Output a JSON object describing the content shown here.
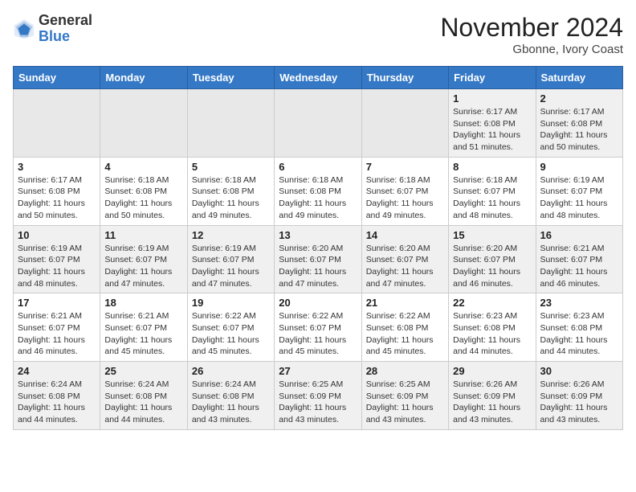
{
  "header": {
    "logo_general": "General",
    "logo_blue": "Blue",
    "month_year": "November 2024",
    "location": "Gbonne, Ivory Coast"
  },
  "weekdays": [
    "Sunday",
    "Monday",
    "Tuesday",
    "Wednesday",
    "Thursday",
    "Friday",
    "Saturday"
  ],
  "weeks": [
    [
      {
        "day": "",
        "info": ""
      },
      {
        "day": "",
        "info": ""
      },
      {
        "day": "",
        "info": ""
      },
      {
        "day": "",
        "info": ""
      },
      {
        "day": "",
        "info": ""
      },
      {
        "day": "1",
        "info": "Sunrise: 6:17 AM\nSunset: 6:08 PM\nDaylight: 11 hours and 51 minutes."
      },
      {
        "day": "2",
        "info": "Sunrise: 6:17 AM\nSunset: 6:08 PM\nDaylight: 11 hours and 50 minutes."
      }
    ],
    [
      {
        "day": "3",
        "info": "Sunrise: 6:17 AM\nSunset: 6:08 PM\nDaylight: 11 hours and 50 minutes."
      },
      {
        "day": "4",
        "info": "Sunrise: 6:18 AM\nSunset: 6:08 PM\nDaylight: 11 hours and 50 minutes."
      },
      {
        "day": "5",
        "info": "Sunrise: 6:18 AM\nSunset: 6:08 PM\nDaylight: 11 hours and 49 minutes."
      },
      {
        "day": "6",
        "info": "Sunrise: 6:18 AM\nSunset: 6:08 PM\nDaylight: 11 hours and 49 minutes."
      },
      {
        "day": "7",
        "info": "Sunrise: 6:18 AM\nSunset: 6:07 PM\nDaylight: 11 hours and 49 minutes."
      },
      {
        "day": "8",
        "info": "Sunrise: 6:18 AM\nSunset: 6:07 PM\nDaylight: 11 hours and 48 minutes."
      },
      {
        "day": "9",
        "info": "Sunrise: 6:19 AM\nSunset: 6:07 PM\nDaylight: 11 hours and 48 minutes."
      }
    ],
    [
      {
        "day": "10",
        "info": "Sunrise: 6:19 AM\nSunset: 6:07 PM\nDaylight: 11 hours and 48 minutes."
      },
      {
        "day": "11",
        "info": "Sunrise: 6:19 AM\nSunset: 6:07 PM\nDaylight: 11 hours and 47 minutes."
      },
      {
        "day": "12",
        "info": "Sunrise: 6:19 AM\nSunset: 6:07 PM\nDaylight: 11 hours and 47 minutes."
      },
      {
        "day": "13",
        "info": "Sunrise: 6:20 AM\nSunset: 6:07 PM\nDaylight: 11 hours and 47 minutes."
      },
      {
        "day": "14",
        "info": "Sunrise: 6:20 AM\nSunset: 6:07 PM\nDaylight: 11 hours and 47 minutes."
      },
      {
        "day": "15",
        "info": "Sunrise: 6:20 AM\nSunset: 6:07 PM\nDaylight: 11 hours and 46 minutes."
      },
      {
        "day": "16",
        "info": "Sunrise: 6:21 AM\nSunset: 6:07 PM\nDaylight: 11 hours and 46 minutes."
      }
    ],
    [
      {
        "day": "17",
        "info": "Sunrise: 6:21 AM\nSunset: 6:07 PM\nDaylight: 11 hours and 46 minutes."
      },
      {
        "day": "18",
        "info": "Sunrise: 6:21 AM\nSunset: 6:07 PM\nDaylight: 11 hours and 45 minutes."
      },
      {
        "day": "19",
        "info": "Sunrise: 6:22 AM\nSunset: 6:07 PM\nDaylight: 11 hours and 45 minutes."
      },
      {
        "day": "20",
        "info": "Sunrise: 6:22 AM\nSunset: 6:07 PM\nDaylight: 11 hours and 45 minutes."
      },
      {
        "day": "21",
        "info": "Sunrise: 6:22 AM\nSunset: 6:08 PM\nDaylight: 11 hours and 45 minutes."
      },
      {
        "day": "22",
        "info": "Sunrise: 6:23 AM\nSunset: 6:08 PM\nDaylight: 11 hours and 44 minutes."
      },
      {
        "day": "23",
        "info": "Sunrise: 6:23 AM\nSunset: 6:08 PM\nDaylight: 11 hours and 44 minutes."
      }
    ],
    [
      {
        "day": "24",
        "info": "Sunrise: 6:24 AM\nSunset: 6:08 PM\nDaylight: 11 hours and 44 minutes."
      },
      {
        "day": "25",
        "info": "Sunrise: 6:24 AM\nSunset: 6:08 PM\nDaylight: 11 hours and 44 minutes."
      },
      {
        "day": "26",
        "info": "Sunrise: 6:24 AM\nSunset: 6:08 PM\nDaylight: 11 hours and 43 minutes."
      },
      {
        "day": "27",
        "info": "Sunrise: 6:25 AM\nSunset: 6:09 PM\nDaylight: 11 hours and 43 minutes."
      },
      {
        "day": "28",
        "info": "Sunrise: 6:25 AM\nSunset: 6:09 PM\nDaylight: 11 hours and 43 minutes."
      },
      {
        "day": "29",
        "info": "Sunrise: 6:26 AM\nSunset: 6:09 PM\nDaylight: 11 hours and 43 minutes."
      },
      {
        "day": "30",
        "info": "Sunrise: 6:26 AM\nSunset: 6:09 PM\nDaylight: 11 hours and 43 minutes."
      }
    ]
  ]
}
